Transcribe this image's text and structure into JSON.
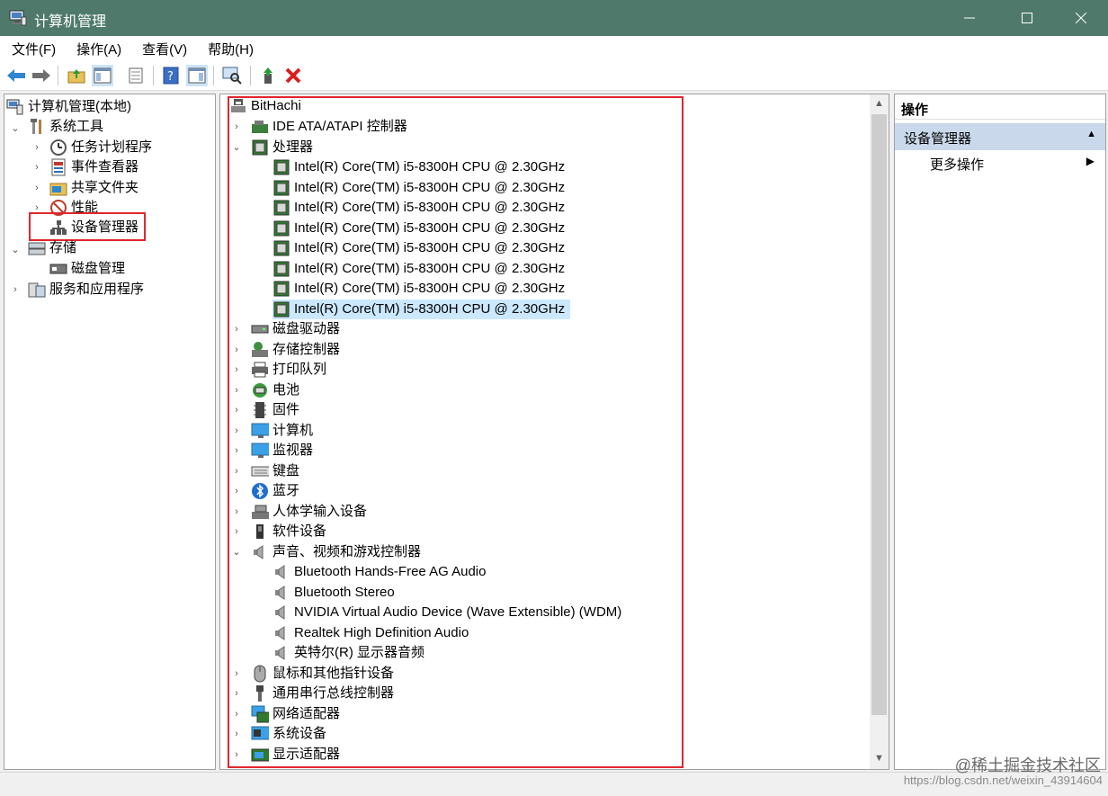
{
  "window": {
    "title": "计算机管理"
  },
  "menu": [
    "文件(F)",
    "操作(A)",
    "查看(V)",
    "帮助(H)"
  ],
  "left_tree": {
    "root": "计算机管理(本地)",
    "items": [
      "系统工具",
      "任务计划程序",
      "事件查看器",
      "共享文件夹",
      "性能",
      "设备管理器",
      "存储",
      "磁盘管理",
      "服务和应用程序"
    ]
  },
  "device_tree": {
    "root": "BitHachi",
    "items": [
      "IDE ATA/ATAPI 控制器",
      "处理器",
      "Intel(R) Core(TM) i5-8300H CPU @ 2.30GHz",
      "Intel(R) Core(TM) i5-8300H CPU @ 2.30GHz",
      "Intel(R) Core(TM) i5-8300H CPU @ 2.30GHz",
      "Intel(R) Core(TM) i5-8300H CPU @ 2.30GHz",
      "Intel(R) Core(TM) i5-8300H CPU @ 2.30GHz",
      "Intel(R) Core(TM) i5-8300H CPU @ 2.30GHz",
      "Intel(R) Core(TM) i5-8300H CPU @ 2.30GHz",
      "Intel(R) Core(TM) i5-8300H CPU @ 2.30GHz",
      "磁盘驱动器",
      "存储控制器",
      "打印队列",
      "电池",
      "固件",
      "计算机",
      "监视器",
      "键盘",
      "蓝牙",
      "人体学输入设备",
      "软件设备",
      "声音、视频和游戏控制器",
      "Bluetooth Hands-Free AG Audio",
      "Bluetooth Stereo",
      "NVIDIA Virtual Audio Device (Wave Extensible) (WDM)",
      "Realtek High Definition Audio",
      "英特尔(R) 显示器音频",
      "鼠标和其他指针设备",
      "通用串行总线控制器",
      "网络适配器",
      "系统设备",
      "显示适配器"
    ]
  },
  "actions": {
    "header": "操作",
    "main": "设备管理器",
    "more": "更多操作"
  },
  "watermark": {
    "line1": "@稀土掘金技术社区",
    "line2": "https://blog.csdn.net/weixin_43914604"
  },
  "colors": {
    "titlebar": "#4f7a6b",
    "highlight_box": "#e0262d",
    "selection": "#cce8ff"
  }
}
